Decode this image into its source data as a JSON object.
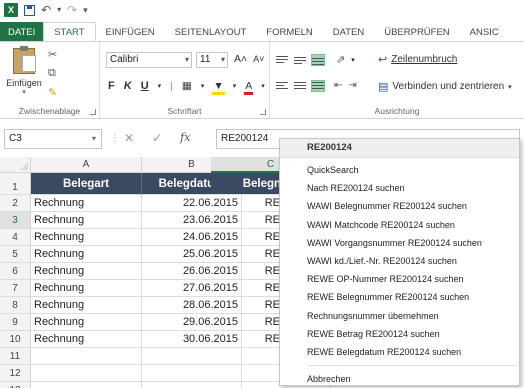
{
  "quick_access": {
    "undo_icon": "undo-icon",
    "redo_icon": "redo-icon",
    "logo": "X"
  },
  "tabs": [
    {
      "label": "DATEI",
      "kind": "file"
    },
    {
      "label": "START",
      "kind": "active"
    },
    {
      "label": "EINFÜGEN",
      "kind": ""
    },
    {
      "label": "SEITENLAYOUT",
      "kind": ""
    },
    {
      "label": "FORMELN",
      "kind": ""
    },
    {
      "label": "DATEN",
      "kind": ""
    },
    {
      "label": "ÜBERPRÜFEN",
      "kind": ""
    },
    {
      "label": "ANSIC",
      "kind": ""
    }
  ],
  "ribbon": {
    "clipboard_group": "Zwischenablage",
    "paste_label": "Einfügen",
    "font_group": "Schriftart",
    "font_name": "Calibri",
    "font_size": "11",
    "bold": "F",
    "italic": "K",
    "underline": "U",
    "grow_font": "A˄",
    "shrink_font": "A˅",
    "alignment_group": "Ausrichtung",
    "wrap_text": "Zeilenumbruch",
    "merge_center": "Verbinden und zentrieren"
  },
  "formula_bar": {
    "name_box": "C3",
    "formula": "RE200124"
  },
  "columns": [
    "A",
    "B",
    "C"
  ],
  "rows": [
    "1",
    "2",
    "3",
    "4",
    "5",
    "6",
    "7",
    "8",
    "9",
    "10",
    "11",
    "12",
    "13"
  ],
  "table": {
    "headers": [
      "Belegart",
      "Belegdatum",
      "Belegnum"
    ],
    "data": [
      [
        "Rechnung",
        "22.06.2015",
        "RE"
      ],
      [
        "Rechnung",
        "23.06.2015",
        "RE"
      ],
      [
        "Rechnung",
        "24.06.2015",
        "RE"
      ],
      [
        "Rechnung",
        "25.06.2015",
        "RE"
      ],
      [
        "Rechnung",
        "26.06.2015",
        "RE"
      ],
      [
        "Rechnung",
        "27.06.2015",
        "RE"
      ],
      [
        "Rechnung",
        "28.06.2015",
        "RE"
      ],
      [
        "Rechnung",
        "29.06.2015",
        "RE"
      ],
      [
        "Rechnung",
        "30.06.2015",
        "RE"
      ]
    ]
  },
  "context_menu": {
    "title": "RE200124",
    "items": [
      "QuickSearch",
      "Nach RE200124 suchen",
      "WAWI Belegnummer RE200124 suchen",
      "WAWI Matchcode RE200124 suchen",
      "WAWI Vorgangsnummer RE200124 suchen",
      "WAWI kd./Lief.-Nr. RE200124 suchen",
      "REWE OP-Nummer RE200124 suchen",
      "REWE Belegnummer RE200124 suchen",
      "Rechnungsnummer übernehmen",
      "REWE Betrag RE200124 suchen",
      "REWE Belegdatum RE200124 suchen"
    ],
    "cancel": "Abbrechen"
  },
  "colors": {
    "excel_green": "#217346",
    "header_fill": "#3a4a63"
  }
}
